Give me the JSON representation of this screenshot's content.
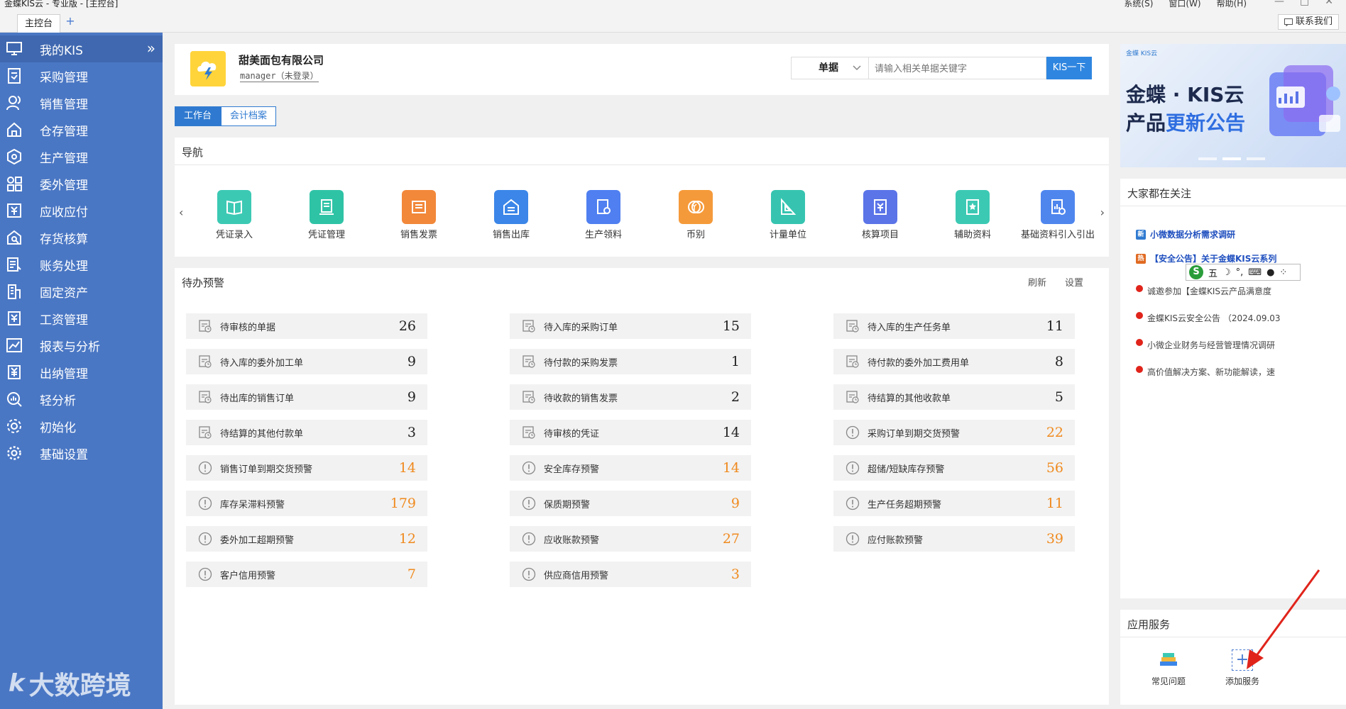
{
  "window": {
    "title": "金蝶KIS云 - 专业版 - [主控台]",
    "menus": [
      "系统(S)",
      "窗口(W)",
      "帮助(H)"
    ],
    "controls": [
      "—",
      "□",
      "✕"
    ]
  },
  "tabbar": {
    "main_tab": "主控台",
    "add_tab": "+",
    "contact": "联系我们"
  },
  "sidebar": {
    "items": [
      {
        "label": "我的KIS",
        "icon": "monitor-icon"
      },
      {
        "label": "采购管理",
        "icon": "purchase-icon"
      },
      {
        "label": "销售管理",
        "icon": "sales-icon"
      },
      {
        "label": "仓存管理",
        "icon": "warehouse-icon"
      },
      {
        "label": "生产管理",
        "icon": "production-icon"
      },
      {
        "label": "委外管理",
        "icon": "outsource-icon"
      },
      {
        "label": "应收应付",
        "icon": "receivable-icon"
      },
      {
        "label": "存货核算",
        "icon": "inventory-icon"
      },
      {
        "label": "账务处理",
        "icon": "ledger-icon"
      },
      {
        "label": "固定资产",
        "icon": "asset-icon"
      },
      {
        "label": "工资管理",
        "icon": "salary-icon"
      },
      {
        "label": "报表与分析",
        "icon": "report-icon"
      },
      {
        "label": "出纳管理",
        "icon": "cashier-icon"
      },
      {
        "label": "轻分析",
        "icon": "analysis-icon"
      },
      {
        "label": "初始化",
        "icon": "init-icon"
      },
      {
        "label": "基础设置",
        "icon": "settings-icon"
      }
    ],
    "collapse": "»"
  },
  "watermark": {
    "logo": "k",
    "text": "大数跨境"
  },
  "company": {
    "name": "甜美面包有限公司",
    "user": "manager（未登录）"
  },
  "search": {
    "type": "单据",
    "placeholder": "请输入相关单据关键字",
    "button": "KIS一下"
  },
  "view_tabs": [
    "工作台",
    "会计档案"
  ],
  "nav": {
    "title": "导航",
    "prev": "‹",
    "next": "›",
    "items": [
      {
        "label": "凭证录入",
        "color": "#3cc9b4"
      },
      {
        "label": "凭证管理",
        "color": "#2fc3a6"
      },
      {
        "label": "销售发票",
        "color": "#f2883a"
      },
      {
        "label": "销售出库",
        "color": "#3b86e8"
      },
      {
        "label": "生产领料",
        "color": "#4f7ff0"
      },
      {
        "label": "币别",
        "color": "#f59a3a"
      },
      {
        "label": "计量单位",
        "color": "#36c4b0"
      },
      {
        "label": "核算项目",
        "color": "#5b74e8"
      },
      {
        "label": "辅助资料",
        "color": "#3cc9b4"
      },
      {
        "label": "基础资料引入引出",
        "color": "#4f86ee"
      }
    ]
  },
  "todo": {
    "title": "待办预警",
    "refresh": "刷新",
    "settings": "设置",
    "columns": [
      [
        {
          "label": "待审核的单据",
          "count": "26",
          "kind": "doc"
        },
        {
          "label": "待入库的委外加工单",
          "count": "9",
          "kind": "doc"
        },
        {
          "label": "待出库的销售订单",
          "count": "9",
          "kind": "doc"
        },
        {
          "label": "待结算的其他付款单",
          "count": "3",
          "kind": "doc"
        },
        {
          "label": "销售订单到期交货预警",
          "count": "14",
          "kind": "warn"
        },
        {
          "label": "库存呆滞料预警",
          "count": "179",
          "kind": "warn"
        },
        {
          "label": "委外加工超期预警",
          "count": "12",
          "kind": "warn"
        },
        {
          "label": "客户信用预警",
          "count": "7",
          "kind": "warn"
        }
      ],
      [
        {
          "label": "待入库的采购订单",
          "count": "15",
          "kind": "doc"
        },
        {
          "label": "待付款的采购发票",
          "count": "1",
          "kind": "doc"
        },
        {
          "label": "待收款的销售发票",
          "count": "2",
          "kind": "doc"
        },
        {
          "label": "待审核的凭证",
          "count": "14",
          "kind": "doc"
        },
        {
          "label": "安全库存预警",
          "count": "14",
          "kind": "warn"
        },
        {
          "label": "保质期预警",
          "count": "9",
          "kind": "warn"
        },
        {
          "label": "应收账款预警",
          "count": "27",
          "kind": "warn"
        },
        {
          "label": "供应商信用预警",
          "count": "3",
          "kind": "warn"
        }
      ],
      [
        {
          "label": "待入库的生产任务单",
          "count": "11",
          "kind": "doc"
        },
        {
          "label": "待付款的委外加工费用单",
          "count": "8",
          "kind": "doc"
        },
        {
          "label": "待结算的其他收款单",
          "count": "5",
          "kind": "doc"
        },
        {
          "label": "采购订单到期交货预警",
          "count": "22",
          "kind": "warn"
        },
        {
          "label": "超储/短缺库存预警",
          "count": "56",
          "kind": "warn"
        },
        {
          "label": "生产任务超期预警",
          "count": "11",
          "kind": "warn"
        },
        {
          "label": "应付账款预警",
          "count": "39",
          "kind": "warn"
        }
      ]
    ]
  },
  "banner": {
    "small": "金蝶 KIS云",
    "line1": "金蝶 · KIS云",
    "line2a": "产品",
    "line2b": "更新公告"
  },
  "focus": {
    "title": "大家都在关注",
    "items": [
      {
        "text": "小微数据分析需求调研",
        "style": "hot",
        "tag": "新"
      },
      {
        "text": "【安全公告】关于金蝶KIS云系列",
        "style": "hot",
        "tag": "热"
      },
      {
        "text": "诚邀参加【金蝶KIS云产品满意度",
        "style": "normal",
        "tag": ""
      },
      {
        "text": "金蝶KIS云安全公告 （2024.09.03",
        "style": "normal",
        "tag": ""
      },
      {
        "text": "小微企业财务与经营管理情况调研",
        "style": "normal",
        "tag": ""
      },
      {
        "text": "高价值解决方案、新功能解读，速",
        "style": "normal",
        "tag": ""
      }
    ],
    "ime": {
      "logo": "S",
      "text": "五"
    }
  },
  "services": {
    "title": "应用服务",
    "items": [
      {
        "label": "常见问题",
        "icon": "faq-books-icon"
      },
      {
        "label": "添加服务",
        "icon": "add-service-icon"
      }
    ]
  }
}
